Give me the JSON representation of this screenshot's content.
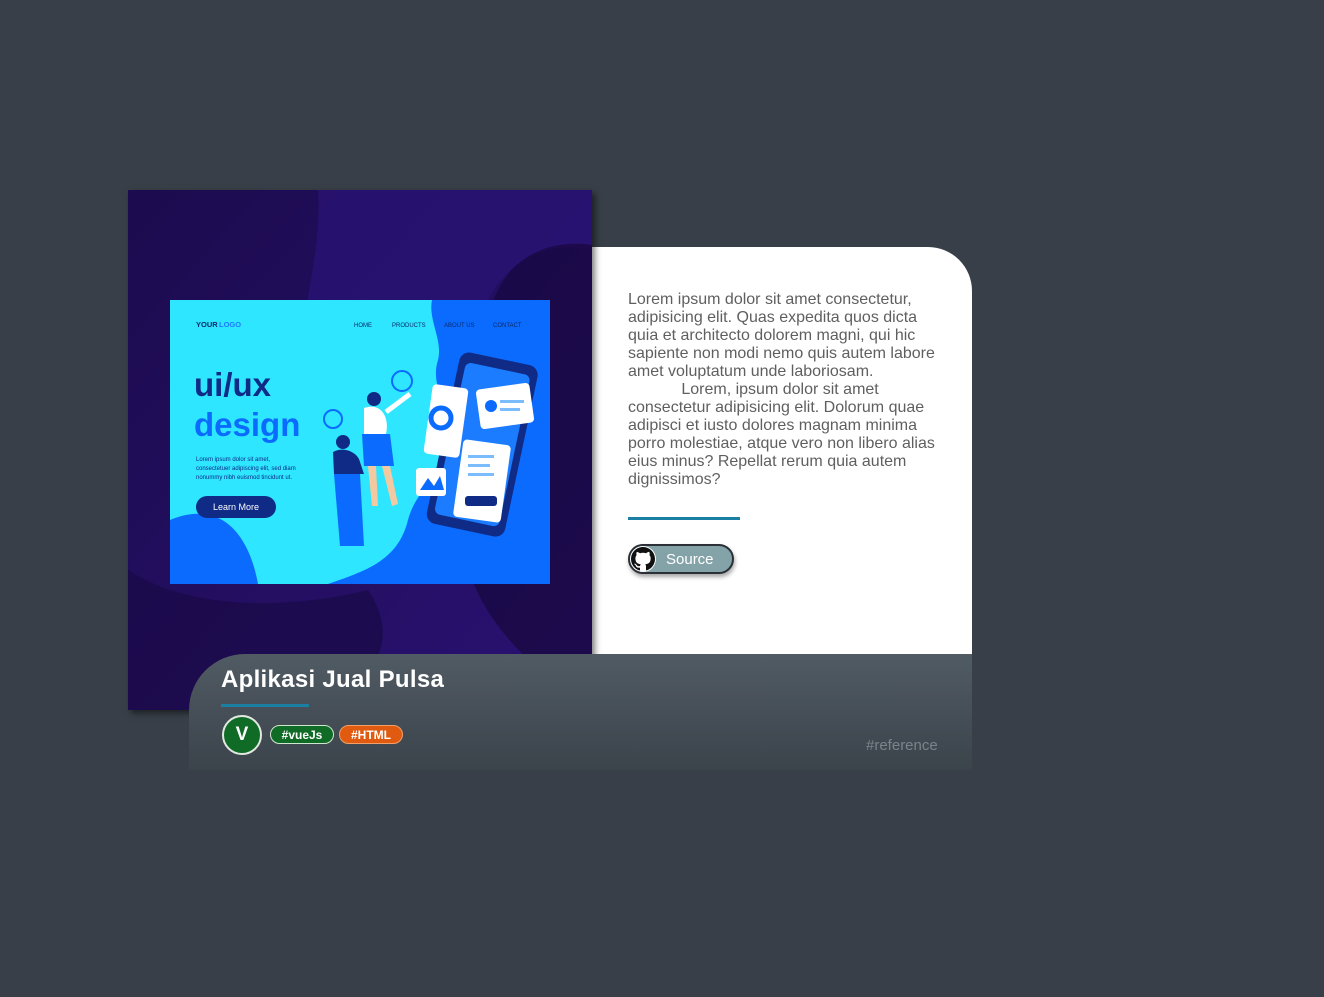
{
  "project": {
    "title": "Aplikasi Jual Pulsa",
    "description": "Lorem ipsum dolor sit amet consectetur, adipisicing elit. Quas expedita quos dicta quia et architecto dolorem magni, qui hic sapiente non modi nemo quis autem labore amet voluptatum unde laboriosam.\n            Lorem, ipsum dolor sit amet consectetur adipisicing elit. Dolorum quae adipisci et iusto dolores magnam minima porro molestiae, atque vero non libero alias eius minus? Repellat rerum quia autem dignissimos?",
    "source_label": "Source",
    "source_icon": "github-icon",
    "avatar_letter": "V",
    "tags": [
      {
        "label": "#vueJs",
        "color": "#0f6b26"
      },
      {
        "label": "#HTML",
        "color": "#e05a10"
      }
    ],
    "reference_label": "#reference"
  },
  "illustration": {
    "logo_your": "YOUR",
    "logo_logo": "LOGO",
    "nav": [
      "HOME",
      "PRODUCTS",
      "ABOUT US",
      "CONTACT"
    ],
    "headline_1": "ui/ux",
    "headline_2": "design",
    "body_lines": [
      "Lorem ipsum dolor sit amet,",
      "consectetuer adipiscing elit, sed diam",
      "nonummy nibh euismod tincidunt ut."
    ],
    "cta": "Learn More"
  },
  "colors": {
    "background": "#383f48",
    "accent_line": "#1a7fa3",
    "illustration_bg": "#22105a",
    "mock_cyan": "#2ee6ff",
    "mock_blue": "#0b6bff"
  }
}
